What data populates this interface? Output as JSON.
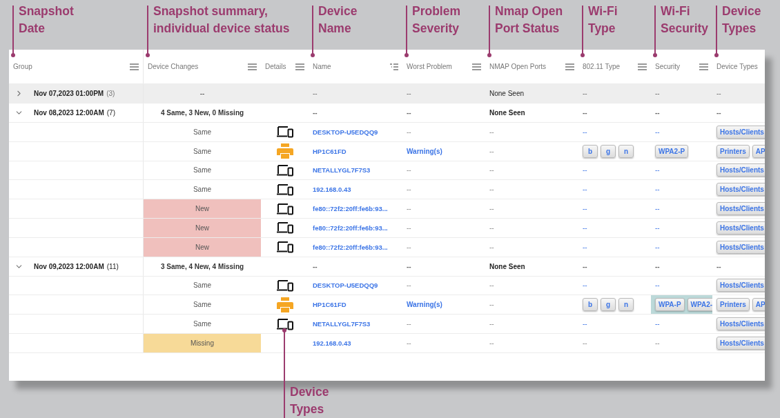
{
  "columns": [
    {
      "label": "Group",
      "kind": "menu",
      "callout": "Snapshot\nDate"
    },
    {
      "label": "Device Changes",
      "kind": "menu",
      "callout": "Snapshot summary,\nindividual device status"
    },
    {
      "label": "Details",
      "kind": "menu"
    },
    {
      "label": "Name",
      "kind": "filter",
      "callout": "Device\nName"
    },
    {
      "label": "Worst Problem",
      "kind": "menu",
      "callout": "Problem\nSeverity"
    },
    {
      "label": "NMAP Open Ports",
      "kind": "menu",
      "callout": "Nmap Open\nPort Status"
    },
    {
      "label": "802.11 Type",
      "kind": "menu",
      "callout": "Wi-Fi\nType"
    },
    {
      "label": "Security",
      "kind": "menu",
      "callout": "Wi-Fi\nSecurity"
    },
    {
      "label": "Device Types",
      "kind": "plain",
      "callout": "Device\nTypes"
    }
  ],
  "groups": [
    {
      "date": "Nov 07,2023 01:00PM",
      "count": "(3)",
      "expanded": false,
      "selected": true,
      "summary": "--",
      "name": "--",
      "problem": "--",
      "ports": "None Seen",
      "wifi": "--",
      "security": "--",
      "types": "--"
    },
    {
      "date": "Nov 08,2023 12:00AM",
      "count": "(7)",
      "expanded": true,
      "selected": false,
      "summary": "4 Same, 3 New, 0 Missing",
      "name": "--",
      "problem": "--",
      "ports": "None Seen",
      "wifi": "--",
      "security": "--",
      "types": "--",
      "rows": [
        {
          "status": {
            "text": "Same",
            "kind": "same"
          },
          "kind": "computer",
          "name": "DESKTOP-U5EDQQ9",
          "problem": {
            "text": "--",
            "link": false
          },
          "ports": "--",
          "wifi": {
            "text": "--",
            "link": true
          },
          "security": {
            "text": "--",
            "link": true,
            "selected": false
          },
          "types": [
            "Hosts/Clients"
          ]
        },
        {
          "status": {
            "text": "Same",
            "kind": "same"
          },
          "kind": "printer",
          "name": "HP1C61FD",
          "problem": {
            "text": "Warning(s)",
            "link": true
          },
          "ports": "--",
          "wifi": {
            "tags": [
              "b",
              "g",
              "n"
            ]
          },
          "security": {
            "tags": [
              "WPA2-P"
            ],
            "selected": false
          },
          "types": [
            "Printers",
            "AP"
          ]
        },
        {
          "status": {
            "text": "Same",
            "kind": "same"
          },
          "kind": "computer",
          "name": "NETALLYGL7F7S3",
          "problem": {
            "text": "--",
            "link": false
          },
          "ports": "--",
          "wifi": {
            "text": "--",
            "link": true
          },
          "security": {
            "text": "--",
            "link": true,
            "selected": false
          },
          "types": [
            "Hosts/Clients"
          ]
        },
        {
          "status": {
            "text": "Same",
            "kind": "same"
          },
          "kind": "computer",
          "name": "192.168.0.43",
          "problem": {
            "text": "--",
            "link": false
          },
          "ports": "--",
          "wifi": {
            "text": "--",
            "link": true
          },
          "security": {
            "text": "--",
            "link": true,
            "selected": false
          },
          "types": [
            "Hosts/Clients"
          ]
        },
        {
          "status": {
            "text": "New",
            "kind": "new"
          },
          "kind": "computer",
          "name": "fe80::72f2:20ff:fe6b:93...",
          "problem": {
            "text": "--",
            "link": false
          },
          "ports": "--",
          "wifi": {
            "text": "--",
            "link": true
          },
          "security": {
            "text": "--",
            "link": true,
            "selected": false
          },
          "types": [
            "Hosts/Clients"
          ]
        },
        {
          "status": {
            "text": "New",
            "kind": "new"
          },
          "kind": "computer",
          "name": "fe80::72f2:20ff:fe6b:93...",
          "problem": {
            "text": "--",
            "link": false
          },
          "ports": "--",
          "wifi": {
            "text": "--",
            "link": true
          },
          "security": {
            "text": "--",
            "link": true,
            "selected": false
          },
          "types": [
            "Hosts/Clients"
          ]
        },
        {
          "status": {
            "text": "New",
            "kind": "new"
          },
          "kind": "computer",
          "name": "fe80::72f2:20ff:fe6b:93...",
          "problem": {
            "text": "--",
            "link": false
          },
          "ports": "--",
          "wifi": {
            "text": "--",
            "link": true
          },
          "security": {
            "text": "--",
            "link": true,
            "selected": false
          },
          "types": [
            "Hosts/Clients"
          ]
        }
      ]
    },
    {
      "date": "Nov 09,2023 12:00AM",
      "count": "(11)",
      "expanded": true,
      "selected": false,
      "summary": "3 Same, 4 New, 4 Missing",
      "name": "--",
      "problem": "--",
      "ports": "None Seen",
      "wifi": "--",
      "security": "--",
      "types": "--",
      "rows": [
        {
          "status": {
            "text": "Same",
            "kind": "same"
          },
          "kind": "computer",
          "name": "DESKTOP-U5EDQQ9",
          "problem": {
            "text": "--",
            "link": false
          },
          "ports": "--",
          "wifi": {
            "text": "--",
            "link": true
          },
          "security": {
            "text": "--",
            "link": true,
            "selected": false
          },
          "types": [
            "Hosts/Clients"
          ]
        },
        {
          "status": {
            "text": "Same",
            "kind": "same"
          },
          "kind": "printer",
          "name": "HP1C61FD",
          "problem": {
            "text": "Warning(s)",
            "link": true
          },
          "ports": "--",
          "wifi": {
            "tags": [
              "b",
              "g",
              "n"
            ]
          },
          "security": {
            "tags": [
              "WPA-P",
              "WPA2-"
            ],
            "selected": true
          },
          "types": [
            "Printers",
            "AP"
          ]
        },
        {
          "status": {
            "text": "Same",
            "kind": "same"
          },
          "kind": "computer",
          "name": "NETALLYGL7F7S3",
          "problem": {
            "text": "--",
            "link": false
          },
          "ports": "--",
          "wifi": {
            "text": "--",
            "link": true
          },
          "security": {
            "text": "--",
            "link": true,
            "selected": false
          },
          "types": [
            "Hosts/Clients"
          ]
        },
        {
          "status": {
            "text": "Missing",
            "kind": "missing"
          },
          "kind": "none",
          "name": "192.168.0.43",
          "problem": {
            "text": "--",
            "link": false
          },
          "ports": "--",
          "wifi": {
            "text": "--",
            "link": false
          },
          "security": {
            "text": "--",
            "link": false,
            "selected": false
          },
          "types": [
            "Hosts/Clients"
          ]
        }
      ]
    }
  ],
  "bottom_callout": "Device\nTypes"
}
